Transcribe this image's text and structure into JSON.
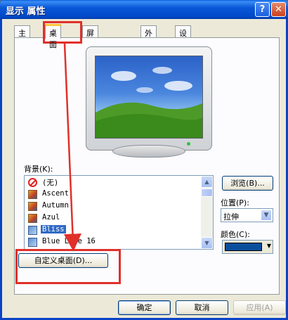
{
  "window": {
    "title": "显示 属性",
    "help_label": "?",
    "close_label": "✕"
  },
  "tabs": [
    {
      "label": "主题",
      "active": false
    },
    {
      "label": "桌面",
      "active": true
    },
    {
      "label": "屏幕保护程序",
      "active": false
    },
    {
      "label": "外观",
      "active": false
    },
    {
      "label": "设置",
      "active": false
    }
  ],
  "desktop": {
    "background_label": "背景(K):",
    "backgrounds": [
      {
        "name": "(无)",
        "icon": "none-icon",
        "selected": false
      },
      {
        "name": "Ascent",
        "icon": "image-icon",
        "selected": false
      },
      {
        "name": "Autumn",
        "icon": "image-icon",
        "selected": false
      },
      {
        "name": "Azul",
        "icon": "image-icon",
        "selected": false
      },
      {
        "name": "Bliss",
        "icon": "image-icon",
        "selected": true
      },
      {
        "name": "Blue Lace 16",
        "icon": "image-icon",
        "selected": false
      }
    ],
    "browse_label": "浏览(B)...",
    "position_label": "位置(P):",
    "position_value": "拉伸",
    "color_label": "颜色(C):",
    "color_value": "#0a4f9c",
    "customize_label": "自定义桌面(D)..."
  },
  "footer": {
    "ok_label": "确定",
    "cancel_label": "取消",
    "apply_label": "应用(A)"
  },
  "annotations": {
    "highlight_color": "#e0302a"
  }
}
